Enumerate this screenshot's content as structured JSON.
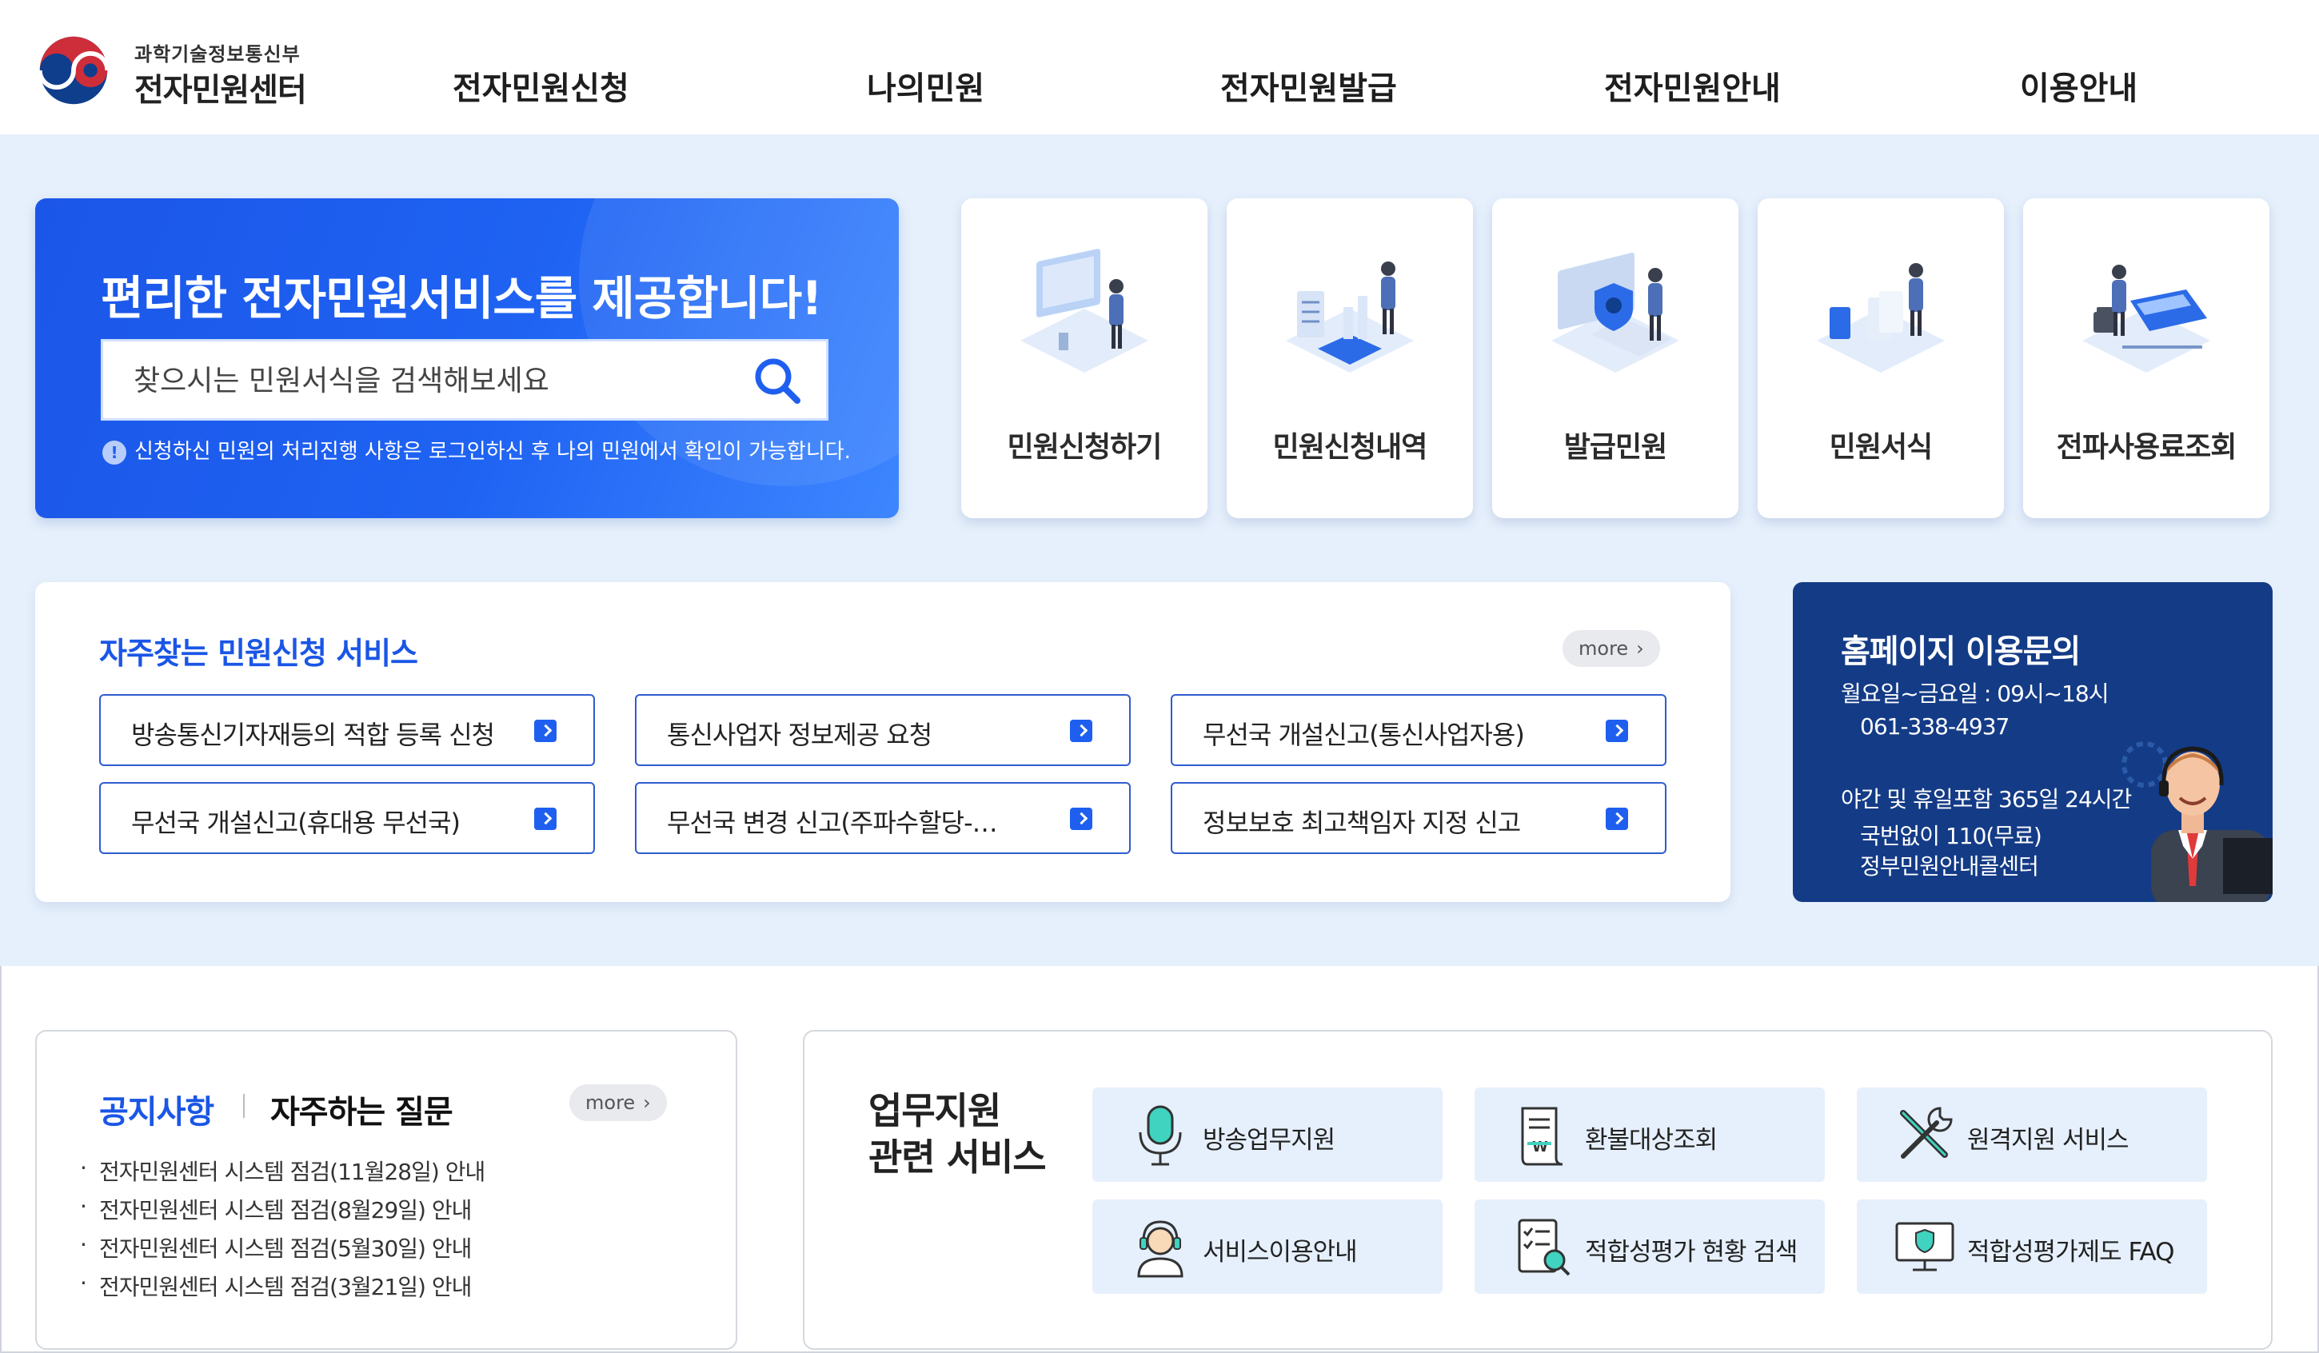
{
  "header": {
    "logo_ministry": "과학기술정보통신부",
    "logo_center": "전자민원센터",
    "nav": [
      "전자민원신청",
      "나의민원",
      "전자민원발급",
      "전자민원안내",
      "이용안내"
    ]
  },
  "hero": {
    "title": "편리한 전자민원서비스를 제공합니다!",
    "search_placeholder": "찾으시는 민원서식을 검색해보세요",
    "note_icon": "!",
    "note": "신청하신 민원의 처리진행 사항은 로그인하신 후 나의 민원에서 확인이 가능합니다."
  },
  "quick_links": [
    {
      "label": "민원신청하기",
      "icon": "monitor-person-icon"
    },
    {
      "label": "민원신청내역",
      "icon": "clipboard-chart-icon"
    },
    {
      "label": "발급민원",
      "icon": "laptop-shield-icon"
    },
    {
      "label": "민원서식",
      "icon": "documents-icon"
    },
    {
      "label": "전파사용료조회",
      "icon": "calculator-icon"
    }
  ],
  "frequent": {
    "title": "자주찾는 민원신청 서비스",
    "more": "more",
    "items": [
      "방송통신기자재등의 적합 등록 신청",
      "통신사업자 정보제공 요청",
      "무선국 개설신고(통신사업자용)",
      "무선국 개설신고(휴대용 무선국)",
      "무선국 변경 신고(주파수할당-통신사업자용)",
      "정보보호 최고책임자 지정 신고"
    ]
  },
  "contact": {
    "title": "홈페이지 이용문의",
    "weekday_hours": "월요일~금요일 : 09시~18시",
    "phone": "061-338-4937",
    "night_hours": "야간 및 휴일포함 365일 24시간",
    "free_number": "국번없이 110(무료)",
    "call_center": "정부민원안내콜센터"
  },
  "notices": {
    "tab_notice": "공지사항",
    "tab_faq": "자주하는 질문",
    "more": "more",
    "items": [
      "전자민원센터 시스템 점검(11월28일) 안내",
      "전자민원센터 시스템 점검(8월29일) 안내",
      "전자민원센터 시스템 점검(5월30일) 안내",
      "전자민원센터 시스템 점검(3월21일) 안내"
    ]
  },
  "work_support": {
    "title_line1": "업무지원",
    "title_line2": "관련 서비스",
    "items": [
      {
        "label": "방송업무지원",
        "icon": "microphone-icon"
      },
      {
        "label": "환불대상조회",
        "icon": "receipt-icon"
      },
      {
        "label": "원격지원 서비스",
        "icon": "tools-icon"
      },
      {
        "label": "서비스이용안내",
        "icon": "headset-agent-icon"
      },
      {
        "label": "적합성평가 현황 검색",
        "icon": "checklist-search-icon"
      },
      {
        "label": "적합성평가제도 FAQ",
        "icon": "monitor-shield-icon"
      }
    ]
  },
  "colors": {
    "brand_blue": "#1f5ff0",
    "navy": "#143b86",
    "band": "#e6f0fc",
    "logo_red": "#cd2e3a",
    "logo_blue": "#0f3e8c"
  }
}
